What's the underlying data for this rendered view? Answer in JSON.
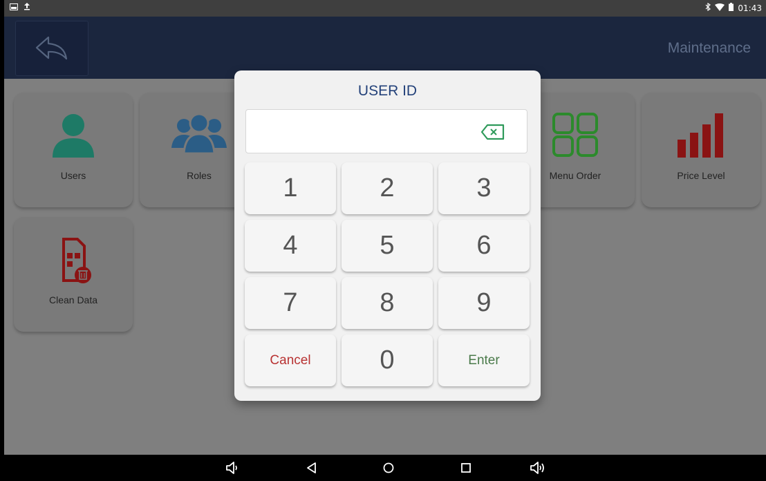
{
  "status_bar": {
    "time": "01:43",
    "left_icons": [
      "screenshot-icon",
      "upload-icon"
    ],
    "right_icons": [
      "bluetooth-icon",
      "wifi-icon",
      "battery-icon"
    ]
  },
  "app_bar": {
    "title": "Maintenance",
    "back_icon": "back-arrow-icon"
  },
  "tiles": {
    "users": {
      "label": "Users",
      "icon": "user-icon",
      "color": "#1e7a66"
    },
    "roles": {
      "label": "Roles",
      "icon": "group-icon",
      "color": "#2b5d86"
    },
    "menu_order": {
      "label": "Menu Order",
      "icon": "grid-icon",
      "color": "#2c8a2c"
    },
    "price_level": {
      "label": "Price Level",
      "icon": "bar-chart-icon",
      "color": "#8a1313"
    },
    "clean_data": {
      "label": "Clean Data",
      "icon": "clean-data-icon",
      "color": "#8a1313"
    }
  },
  "dialog": {
    "title": "USER ID",
    "input_value": "",
    "backspace_icon": "backspace-icon",
    "keys": {
      "k1": "1",
      "k2": "2",
      "k3": "3",
      "k4": "4",
      "k5": "5",
      "k6": "6",
      "k7": "7",
      "k8": "8",
      "k9": "9",
      "k0": "0",
      "cancel": "Cancel",
      "enter": "Enter"
    },
    "colors": {
      "title": "#24427a",
      "cancel": "#b83232",
      "enter": "#4a7a4a",
      "backspace": "#2e9a5a"
    }
  },
  "nav_bar": {
    "icons": [
      "volume-down-icon",
      "back-icon",
      "home-icon",
      "recents-icon",
      "volume-up-icon"
    ]
  }
}
